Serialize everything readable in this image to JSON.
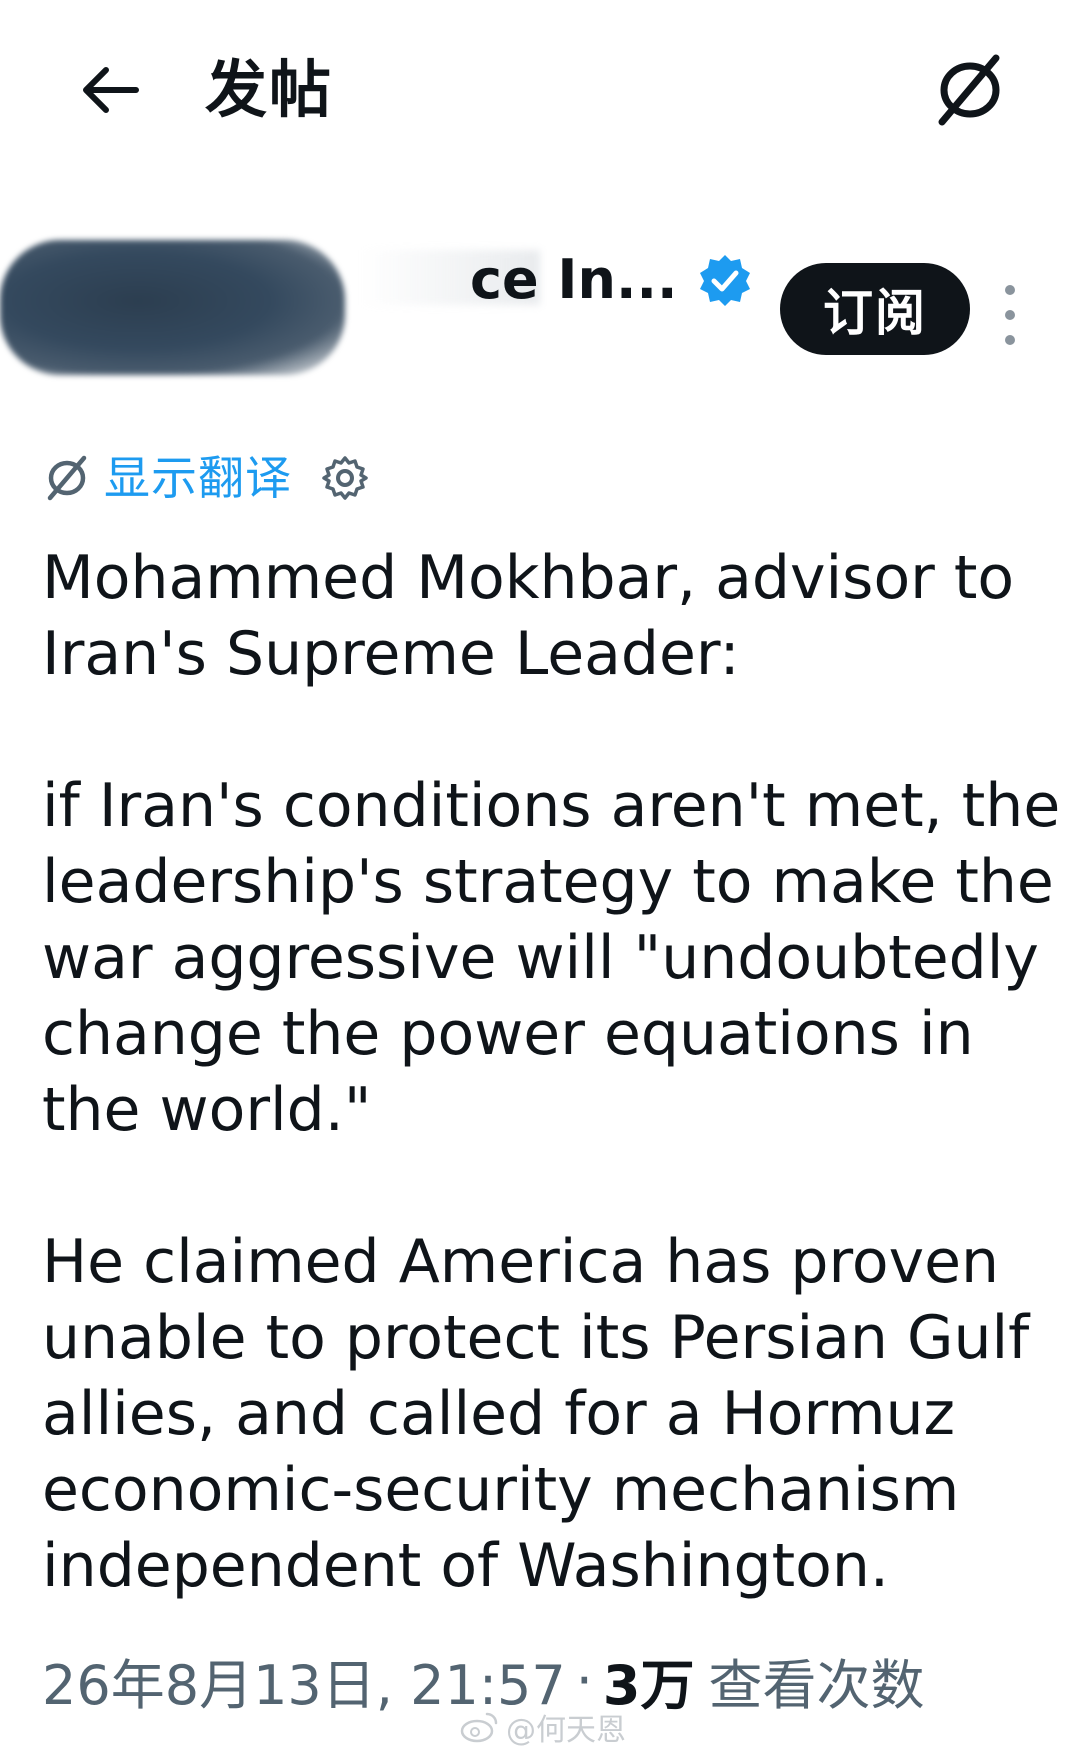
{
  "header": {
    "title": "发帖"
  },
  "author": {
    "name_visible": "ce In...",
    "handle_visible": "",
    "subscribe_label": "订阅"
  },
  "translation": {
    "show_label": "显示翻译"
  },
  "post": {
    "paragraphs": [
      "Mohammed Mokhbar, advisor to Iran's Supreme Leader:",
      "if Iran's conditions aren't met, the leadership's strategy to make the war aggressive will \"undoubtedly change the power equations in the world.\"",
      "He claimed America has proven unable to protect its Persian Gulf allies, and called for a Hormuz economic-security mechanism independent of Washington."
    ]
  },
  "meta": {
    "date": "26年8月13日, 21:57",
    "separator": "·",
    "views_count": "3万",
    "views_label": "查看次数"
  },
  "watermark": {
    "text": "@何天恩"
  },
  "colors": {
    "accent": "#1d9bf0",
    "text": "#0f1419",
    "secondary": "#536471",
    "button_bg": "#0f1419"
  },
  "icons": [
    "back-arrow-icon",
    "translate-icon",
    "verified-badge-icon",
    "more-vertical-icon",
    "settings-gear-icon",
    "weibo-icon"
  ]
}
